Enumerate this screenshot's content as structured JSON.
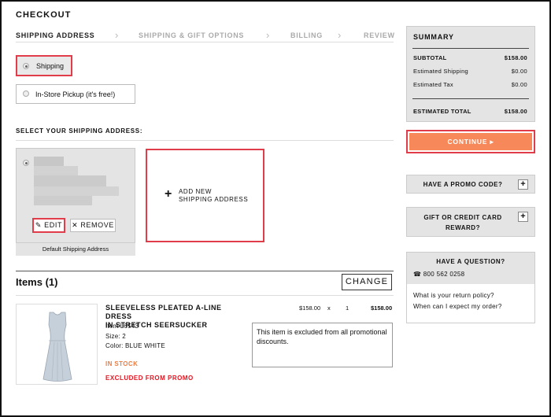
{
  "page": {
    "title": "CHECKOUT"
  },
  "steps": [
    {
      "label": "SHIPPING ADDRESS",
      "active": true
    },
    {
      "label": "SHIPPING & GIFT OPTIONS",
      "active": false
    },
    {
      "label": "BILLING",
      "active": false
    },
    {
      "label": "REVIEW",
      "active": false
    }
  ],
  "delivery": {
    "shipping_label": "Shipping",
    "pickup_label": "In-Store Pickup (it's free!)"
  },
  "address": {
    "section_label": "SELECT YOUR SHIPPING ADDRESS:",
    "edit_label": "EDIT",
    "remove_label": "REMOVE",
    "default_label": "Default Shipping Address",
    "add_new_line1": "ADD NEW",
    "add_new_line2": "SHIPPING ADDRESS"
  },
  "items": {
    "title": "Items (1)",
    "change_label": "CHANGE",
    "product": {
      "name_line1": "SLEEVELESS PLEATED A-LINE DRESS",
      "name_line2": "IN STRETCH SEERSUCKER",
      "item_no": "Item L6543",
      "size": "Size: 2",
      "color": "Color: BLUE WHITE",
      "stock": "IN STOCK",
      "excluded": "EXCLUDED FROM PROMO",
      "price": "$158.00",
      "times": "x",
      "qty": "1",
      "total": "$158.00",
      "promo_note": "This item is excluded from all promotional discounts."
    }
  },
  "summary": {
    "title": "SUMMARY",
    "rows": [
      {
        "label": "SUBTOTAL",
        "value": "$158.00"
      },
      {
        "label": "Estimated Shipping",
        "value": "$0.00"
      },
      {
        "label": "Estimated Tax",
        "value": "$0.00"
      }
    ],
    "total_label": "ESTIMATED TOTAL",
    "total_value": "$158.00"
  },
  "continue_label": "CONTINUE",
  "promo_code_label": "HAVE A PROMO CODE?",
  "gift_card_line1": "GIFT OR CREDIT CARD",
  "gift_card_line2": "REWARD?",
  "help": {
    "title": "HAVE A QUESTION?",
    "phone": "800 562 0258",
    "link1": "What is your return policy?",
    "link2": "When can I expect my order?"
  },
  "colors": {
    "accent": "#f7885a",
    "highlight_border": "#e03c4a",
    "in_stock": "#f07c3f",
    "excluded": "#e8131f"
  }
}
